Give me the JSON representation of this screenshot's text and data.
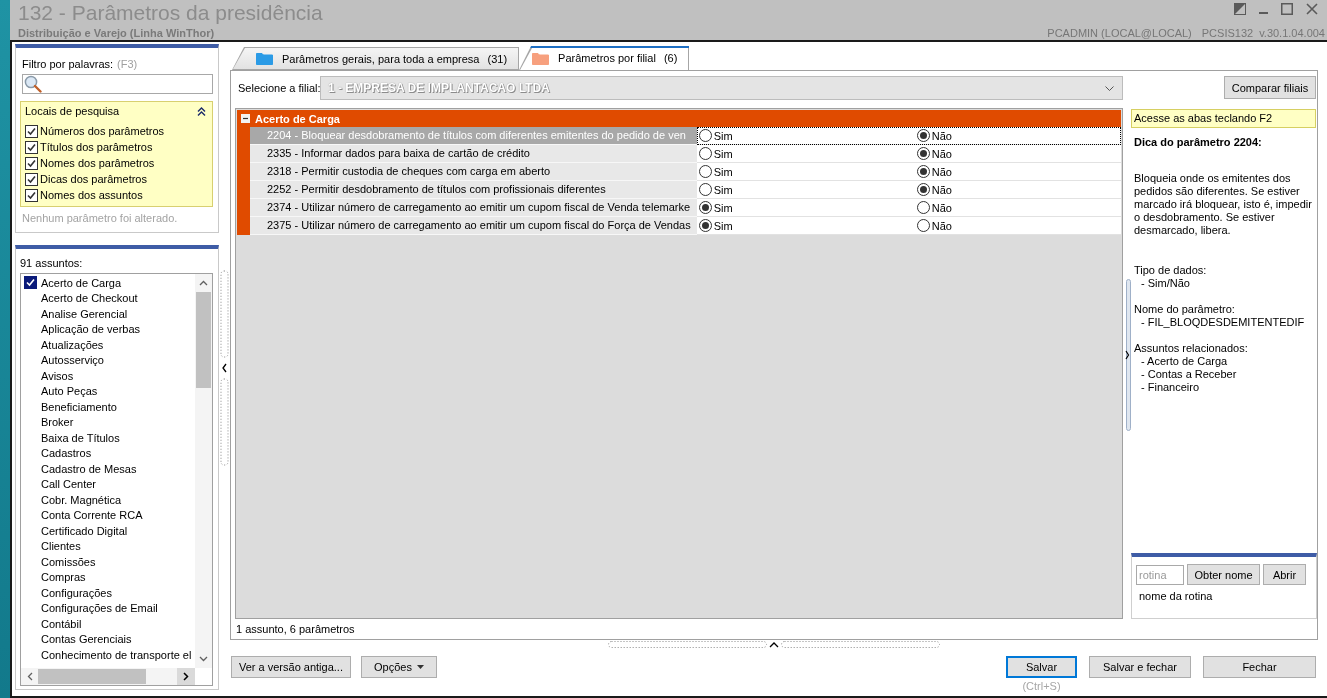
{
  "window": {
    "title": "132 - Parâmetros da presidência",
    "subtitle": "Distribuição e Varejo (Linha WinThor)",
    "user": "PCADMIN (LOCAL@LOCAL)",
    "program": "PCSIS132",
    "version": "v.30.1.04.004"
  },
  "filter": {
    "label": "Filtro por palavras:",
    "shortcut": "(F3)"
  },
  "search_locations": {
    "title": "Locais de pesquisa",
    "expanded": true,
    "options": [
      {
        "label": "Números dos parâmetros",
        "checked": true
      },
      {
        "label": "Títulos dos parâmetros",
        "checked": true
      },
      {
        "label": "Nomes dos parâmetros",
        "checked": true
      },
      {
        "label": "Dicas dos parâmetros",
        "checked": true
      },
      {
        "label": "Nomes dos assuntos",
        "checked": true
      }
    ]
  },
  "change_status": "Nenhum parâmetro foi alterado.",
  "subjects": {
    "count_label": "91 assuntos:",
    "items": [
      {
        "label": "Acerto de Carga",
        "checked": true
      },
      {
        "label": "Acerto de Checkout",
        "checked": false
      },
      {
        "label": "Analise Gerencial",
        "checked": false
      },
      {
        "label": "Aplicação de verbas",
        "checked": false
      },
      {
        "label": "Atualizações",
        "checked": false
      },
      {
        "label": "Autosserviço",
        "checked": false
      },
      {
        "label": "Avisos",
        "checked": false
      },
      {
        "label": "Auto Peças",
        "checked": false
      },
      {
        "label": "Beneficiamento",
        "checked": false
      },
      {
        "label": "Broker",
        "checked": false
      },
      {
        "label": "Baixa de Títulos",
        "checked": false
      },
      {
        "label": "Cadastros",
        "checked": false
      },
      {
        "label": "Cadastro de Mesas",
        "checked": false
      },
      {
        "label": "Call Center",
        "checked": false
      },
      {
        "label": "Cobr. Magnética",
        "checked": false
      },
      {
        "label": "Conta Corrente RCA",
        "checked": false
      },
      {
        "label": "Certificado Digital",
        "checked": false
      },
      {
        "label": "Clientes",
        "checked": false
      },
      {
        "label": "Comissões",
        "checked": false
      },
      {
        "label": "Compras",
        "checked": false
      },
      {
        "label": "Configurações",
        "checked": false
      },
      {
        "label": "Configurações de Email",
        "checked": false
      },
      {
        "label": "Contábil",
        "checked": false
      },
      {
        "label": "Contas Gerenciais",
        "checked": false
      },
      {
        "label": "Conhecimento de transporte el",
        "checked": false
      }
    ]
  },
  "tabs": [
    {
      "label": "Parâmetros gerais, para toda a empresa",
      "count": "(31)",
      "color": "#2b9be6",
      "selected": false
    },
    {
      "label": "Parâmetros por filial",
      "count": "(6)",
      "color": "#f7a07e",
      "selected": true
    }
  ],
  "branch_select": {
    "label": "Selecione a filial:",
    "value": "1 - EMPRESA DE IMPLANTACAO LTDA"
  },
  "compare_button": "Comparar filiais",
  "grid": {
    "groups": [
      {
        "title": "Acerto de Carga",
        "expanded": true,
        "rows": [
          {
            "text": "2204 - Bloquear desdobramento de títulos com diferentes emitentes do pedido de ven",
            "selected": true,
            "options": [
              {
                "label": "Sim",
                "checked": false
              },
              {
                "label": "Não",
                "checked": true
              }
            ]
          },
          {
            "text": "2335 - Informar dados para baixa de cartão de crédito",
            "selected": false,
            "options": [
              {
                "label": "Sim",
                "checked": false
              },
              {
                "label": "Não",
                "checked": true
              }
            ]
          },
          {
            "text": "2318 - Permitir custodia de cheques com carga em aberto",
            "selected": false,
            "options": [
              {
                "label": "Sim",
                "checked": false
              },
              {
                "label": "Não",
                "checked": true
              }
            ]
          },
          {
            "text": "2252 - Permitir desdobramento de títulos com profissionais diferentes",
            "selected": false,
            "options": [
              {
                "label": "Sim",
                "checked": false
              },
              {
                "label": "Não",
                "checked": true
              }
            ]
          },
          {
            "text": "2374 - Utilizar número de carregamento ao emitir um cupom fiscal de Venda telemarke",
            "selected": false,
            "options": [
              {
                "label": "Sim",
                "checked": true
              },
              {
                "label": "Não",
                "checked": false
              }
            ]
          },
          {
            "text": "2375 - Utilizar número de carregamento ao emitir um cupom fiscal do Força de Vendas",
            "selected": false,
            "options": [
              {
                "label": "Sim",
                "checked": true
              },
              {
                "label": "Não",
                "checked": false
              }
            ]
          }
        ]
      }
    ]
  },
  "grid_status": "1 assunto, 6 parâmetros",
  "hint": {
    "banner": "Acesse as abas teclando F2",
    "title": "Dica do parâmetro 2204:",
    "description": "Bloqueia onde os emitentes dos pedidos são diferentes. Se estiver marcado irá bloquear, isto é, impedir o desdobramento. Se estiver desmarcado, libera.",
    "sections": [
      {
        "heading": "Tipo de dados:",
        "items": [
          "- Sim/Não"
        ]
      },
      {
        "heading": "Nome do parâmetro:",
        "items": [
          "- FIL_BLOQDESDEMITENTEDIF"
        ]
      },
      {
        "heading": "Assuntos relacionados:",
        "items": [
          "- Acerto de Carga",
          "- Contas a Receber",
          "- Financeiro"
        ]
      }
    ]
  },
  "routine_lookup": {
    "placeholder": "rotina",
    "buttons": [
      "Obter nome",
      "Abrir"
    ],
    "result": "nome da rotina"
  },
  "footer": {
    "left_buttons": [
      {
        "label": "Ver a versão antiga...",
        "dropdown": false,
        "focused": false
      },
      {
        "label": "Opções",
        "dropdown": true,
        "focused": false
      }
    ],
    "right_buttons": [
      {
        "label": "Salvar",
        "dropdown": false,
        "focused": true,
        "shortcut": "(Ctrl+S)"
      },
      {
        "label": "Salvar e fechar",
        "dropdown": false,
        "focused": false
      },
      {
        "label": "Fechar",
        "dropdown": false,
        "focused": false
      }
    ]
  }
}
